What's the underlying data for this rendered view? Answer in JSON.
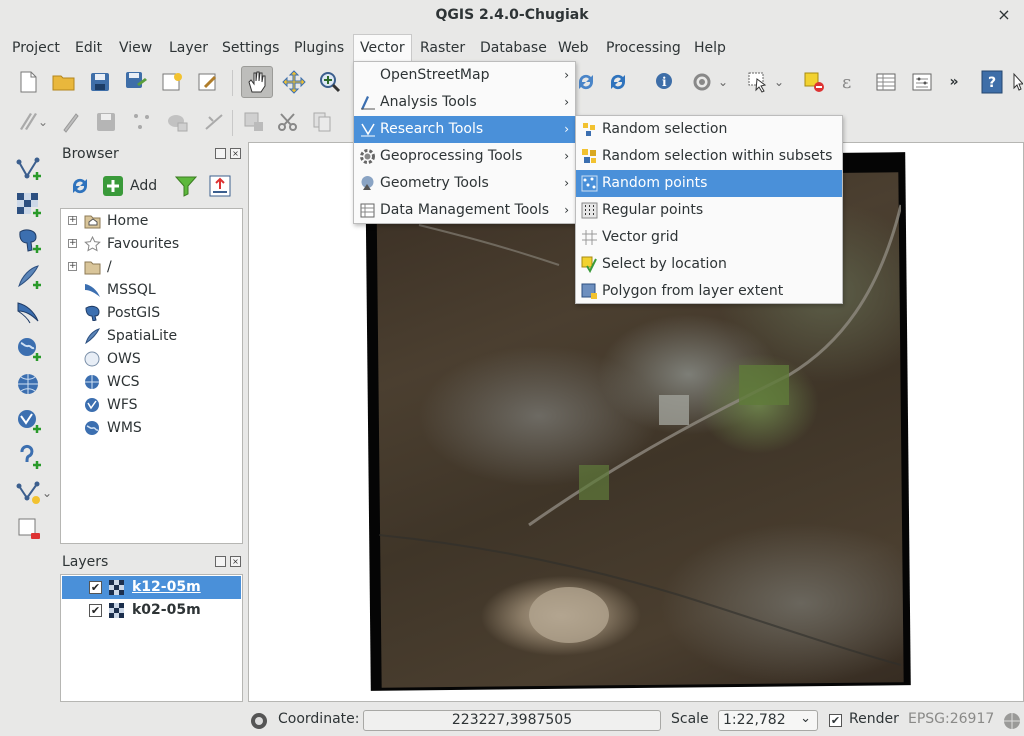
{
  "window": {
    "title": "QGIS 2.4.0-Chugiak",
    "close_glyph": "×"
  },
  "menubar": {
    "items": [
      {
        "label": "Project"
      },
      {
        "label": "Edit"
      },
      {
        "label": "View"
      },
      {
        "label": "Layer"
      },
      {
        "label": "Settings"
      },
      {
        "label": "Plugins"
      },
      {
        "label": "Vector"
      },
      {
        "label": "Raster"
      },
      {
        "label": "Database"
      },
      {
        "label": "Web"
      },
      {
        "label": "Processing"
      },
      {
        "label": "Help"
      }
    ],
    "active": "Vector"
  },
  "vector_menu": {
    "items": [
      {
        "label": "OpenStreetMap",
        "icon": "none",
        "submenu": true
      },
      {
        "label": "Analysis Tools",
        "icon": "analysis-icon",
        "submenu": true
      },
      {
        "label": "Research Tools",
        "icon": "research-icon",
        "submenu": true,
        "highlighted": true
      },
      {
        "label": "Geoprocessing Tools",
        "icon": "gear-icon",
        "submenu": true
      },
      {
        "label": "Geometry Tools",
        "icon": "geometry-icon",
        "submenu": true
      },
      {
        "label": "Data Management Tools",
        "icon": "data-management-icon",
        "submenu": true
      }
    ],
    "arrow_glyph": "›"
  },
  "research_submenu": {
    "items": [
      {
        "label": "Random selection",
        "icon": "random-selection-icon"
      },
      {
        "label": "Random selection within subsets",
        "icon": "random-subset-icon"
      },
      {
        "label": "Random points",
        "icon": "random-points-icon",
        "highlighted": true
      },
      {
        "label": "Regular points",
        "icon": "regular-points-icon"
      },
      {
        "label": "Vector grid",
        "icon": "vector-grid-icon"
      },
      {
        "label": "Select by location",
        "icon": "select-by-location-icon"
      },
      {
        "label": "Polygon from layer extent",
        "icon": "polygon-extent-icon"
      }
    ]
  },
  "browser_panel": {
    "title": "Browser",
    "add_label": "Add",
    "tree": [
      {
        "label": "Home",
        "icon": "home-folder-icon",
        "expandable": true
      },
      {
        "label": "Favourites",
        "icon": "star-icon",
        "expandable": true
      },
      {
        "label": "/",
        "icon": "folder-icon",
        "expandable": true
      },
      {
        "label": "MSSQL",
        "icon": "mssql-icon"
      },
      {
        "label": "PostGIS",
        "icon": "postgis-icon"
      },
      {
        "label": "SpatiaLite",
        "icon": "spatialite-icon"
      },
      {
        "label": "OWS",
        "icon": "ows-icon"
      },
      {
        "label": "WCS",
        "icon": "wcs-icon"
      },
      {
        "label": "WFS",
        "icon": "wfs-icon"
      },
      {
        "label": "WMS",
        "icon": "wms-icon"
      }
    ],
    "expander_glyph": "+"
  },
  "layers_panel": {
    "title": "Layers",
    "layers": [
      {
        "name": "k12-05m",
        "checked": true,
        "selected": true
      },
      {
        "name": "k02-05m",
        "checked": true,
        "selected": false
      }
    ],
    "check_glyph": "✔"
  },
  "statusbar": {
    "coordinate_label": "Coordinate:",
    "coordinate_value": "223227,3987505",
    "scale_label": "Scale",
    "scale_value": "1:22,782",
    "render_label": "Render",
    "render_checked": true,
    "crs": "EPSG:26917",
    "dropdown_glyph": "⌄"
  },
  "colors": {
    "highlight": "#4a90d9",
    "window_bg": "#e8e8e7",
    "menu_bg": "#fafafa"
  },
  "toolbar_overflow_glyph": "»",
  "help_glyph": "?"
}
